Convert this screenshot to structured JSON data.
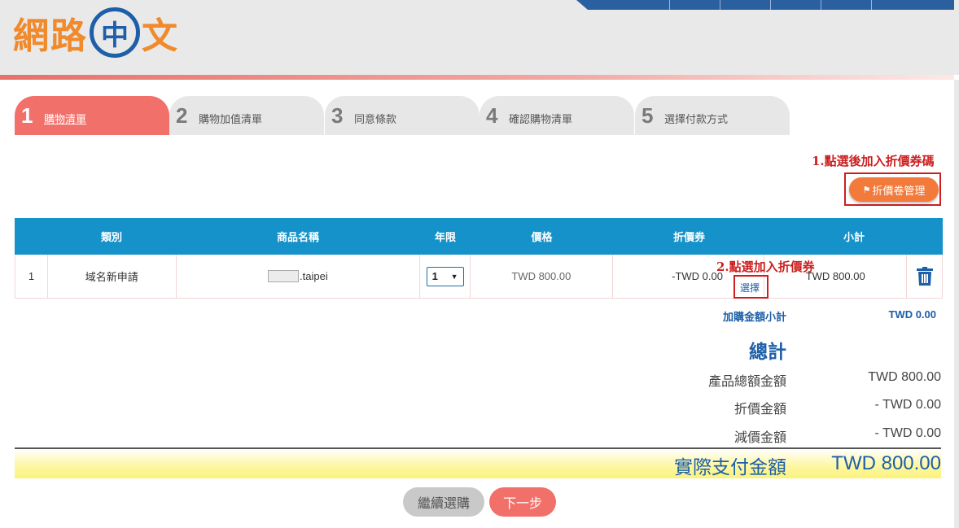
{
  "logo": {
    "part1": "網路",
    "part2": "中",
    "part3": "文"
  },
  "steps": [
    {
      "num": "1",
      "label": "購物清單"
    },
    {
      "num": "2",
      "label": "購物加值清單"
    },
    {
      "num": "3",
      "label": "同意條款"
    },
    {
      "num": "4",
      "label": "確認購物清單"
    },
    {
      "num": "5",
      "label": "選擇付款方式"
    }
  ],
  "annotations": {
    "first": "1.點選後加入折價券碼",
    "second": "2.點選加入折價券"
  },
  "coupon_button": "折價卷管理",
  "table": {
    "headers": [
      "類別",
      "商品名稱",
      "年限",
      "價格",
      "折價券",
      "小計"
    ],
    "row": {
      "index": "1",
      "category": "域名新申請",
      "product_suffix": ".taipei",
      "years": "1",
      "price": "TWD 800.00",
      "discount": "-TWD 0.00",
      "choose": "選擇",
      "subtotal": "TWD 800.00"
    }
  },
  "addon": {
    "label": "加購金額小計",
    "value": "TWD 0.00"
  },
  "totals": {
    "title": "總計",
    "product_total_label": "產品總額金額",
    "product_total_value": "TWD 800.00",
    "discount_label": "折價金額",
    "discount_value": "- TWD 0.00",
    "reduce_label": "減價金額",
    "reduce_value": "- TWD 0.00",
    "final_label": "實際支付金額",
    "final_value": "TWD 800.00"
  },
  "buttons": {
    "continue": "繼續選購",
    "next": "下一步"
  },
  "colors": {
    "accent": "#f2706a",
    "table_header": "#1592c9",
    "link": "#1d5fa8",
    "annotation": "#cc1f1f"
  }
}
